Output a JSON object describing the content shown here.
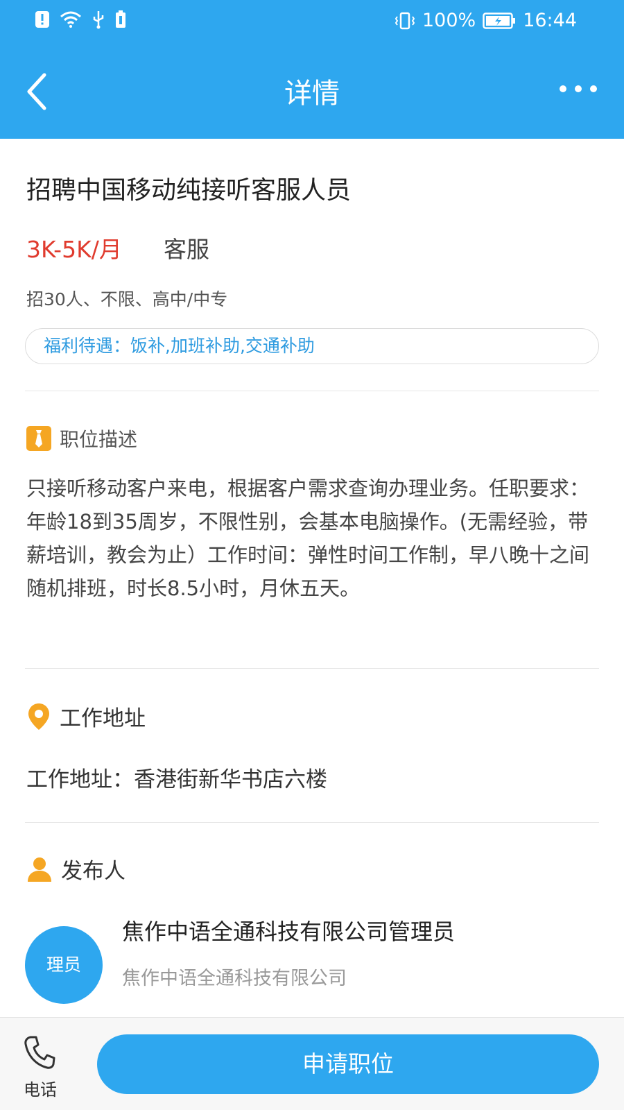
{
  "status_bar": {
    "battery_percent": "100%",
    "time": "16:44"
  },
  "nav": {
    "title": "详情",
    "back_icon": "chevron-left-icon",
    "more_icon": "more-dots-icon"
  },
  "job": {
    "title": "招聘中国移动纯接听客服人员",
    "salary": "3K-5K/月",
    "category": "客服",
    "requirements": "招30人、不限、高中/中专",
    "welfare": "福利待遇：饭补,加班补助,交通补助"
  },
  "description": {
    "title": "职位描述",
    "icon": "tie-icon",
    "text": "只接听移动客户来电，根据客户需求查询办理业务。任职要求：年龄18到35周岁，不限性别，会基本电脑操作。(无需经验，带薪培训，教会为止）工作时间：弹性时间工作制，早八晚十之间随机排班，时长8.5小时，月休五天。"
  },
  "work_address": {
    "title": "工作地址",
    "icon": "location-pin-icon",
    "text": "工作地址：香港街新华书店六楼"
  },
  "publisher": {
    "title": "发布人",
    "icon": "person-icon",
    "avatar_text": "理员",
    "name": "焦作中语全通科技有限公司管理员",
    "company": "焦作中语全通科技有限公司"
  },
  "bottom_bar": {
    "phone_label": "电话",
    "phone_icon": "phone-icon",
    "apply_label": "申请职位"
  },
  "colors": {
    "primary": "#2ea7ef",
    "salary": "#e03b2e",
    "accent_icon": "#f5a623",
    "welfare_text": "#2e9be0"
  }
}
